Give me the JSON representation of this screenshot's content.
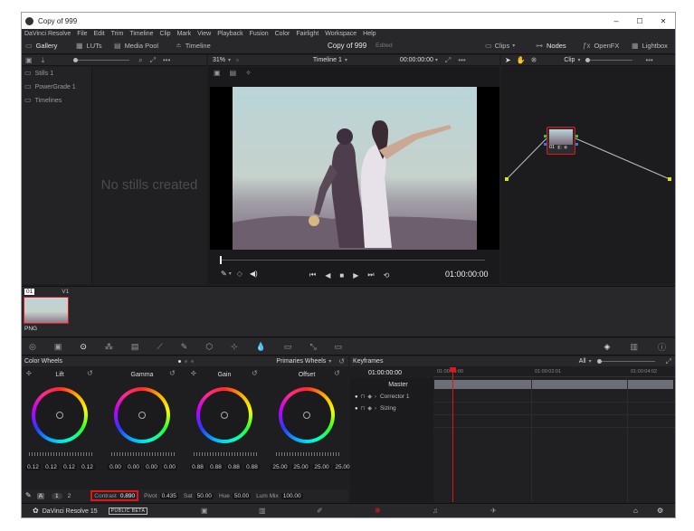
{
  "window": {
    "title": "Copy of 999",
    "controls": [
      "–",
      "☐",
      "✕"
    ]
  },
  "menu": [
    "DaVinci Resolve",
    "File",
    "Edit",
    "Trim",
    "Timeline",
    "Clip",
    "Mark",
    "View",
    "Playback",
    "Fusion",
    "Color",
    "Fairlight",
    "Workspace",
    "Help"
  ],
  "toolbar": {
    "gallery": "Gallery",
    "luts": "LUTs",
    "media_pool": "Media Pool",
    "timeline": "Timeline",
    "project_title": "Copy of 999",
    "project_status": "Edited",
    "clips": "Clips",
    "nodes": "Nodes",
    "openfx": "OpenFX",
    "lightbox": "Lightbox"
  },
  "gallery": {
    "items": [
      "Stills 1",
      "PowerGrade 1",
      "Timelines"
    ],
    "empty_text": "No stills created"
  },
  "viewer": {
    "zoom": "31%",
    "timeline_name": "Timeline 1",
    "timecode_top": "00:00:00:00",
    "timecode": "01:00:00:00"
  },
  "node_panel": {
    "mode": "Clip",
    "node_label": "01"
  },
  "clip_strip": {
    "clip_number": "01",
    "track": "V1",
    "format": "PNG"
  },
  "color_wheels": {
    "title": "Color Wheels",
    "mode": "Primaries Wheels",
    "wheels": [
      {
        "name": "Lift",
        "values": [
          "0.12",
          "0.12",
          "0.12",
          "0.12"
        ]
      },
      {
        "name": "Gamma",
        "values": [
          "0.00",
          "0.00",
          "0.00",
          "0.00"
        ]
      },
      {
        "name": "Gain",
        "values": [
          "0.88",
          "0.88",
          "0.88",
          "0.88"
        ]
      },
      {
        "name": "Offset",
        "values": [
          "25.00",
          "25.00",
          "25.00",
          "25.00"
        ]
      }
    ],
    "page_buttons": [
      "A",
      "1",
      "2"
    ],
    "contrast_label": "Contrast",
    "contrast_value": "0.890",
    "pivot_label": "Pivot",
    "pivot_value": "0.435",
    "sat_label": "Sat",
    "sat_value": "50.00",
    "hue_label": "Hue",
    "hue_value": "50.00",
    "lummix_label": "Lum Mix",
    "lummix_value": "100.00",
    "highlight_color": "#e0161b"
  },
  "keyframes": {
    "title": "Keyframes",
    "filter": "All",
    "current_tc": "01:00:00:00",
    "ruler": [
      "01:00:00:00",
      "01:00:02:01",
      "01:00:04:02"
    ],
    "tracks": [
      "Master",
      "Corrector 1",
      "Sizing"
    ]
  },
  "footer": {
    "app_name": "DaVinci Resolve 15",
    "badge": "PUBLIC BETA"
  }
}
